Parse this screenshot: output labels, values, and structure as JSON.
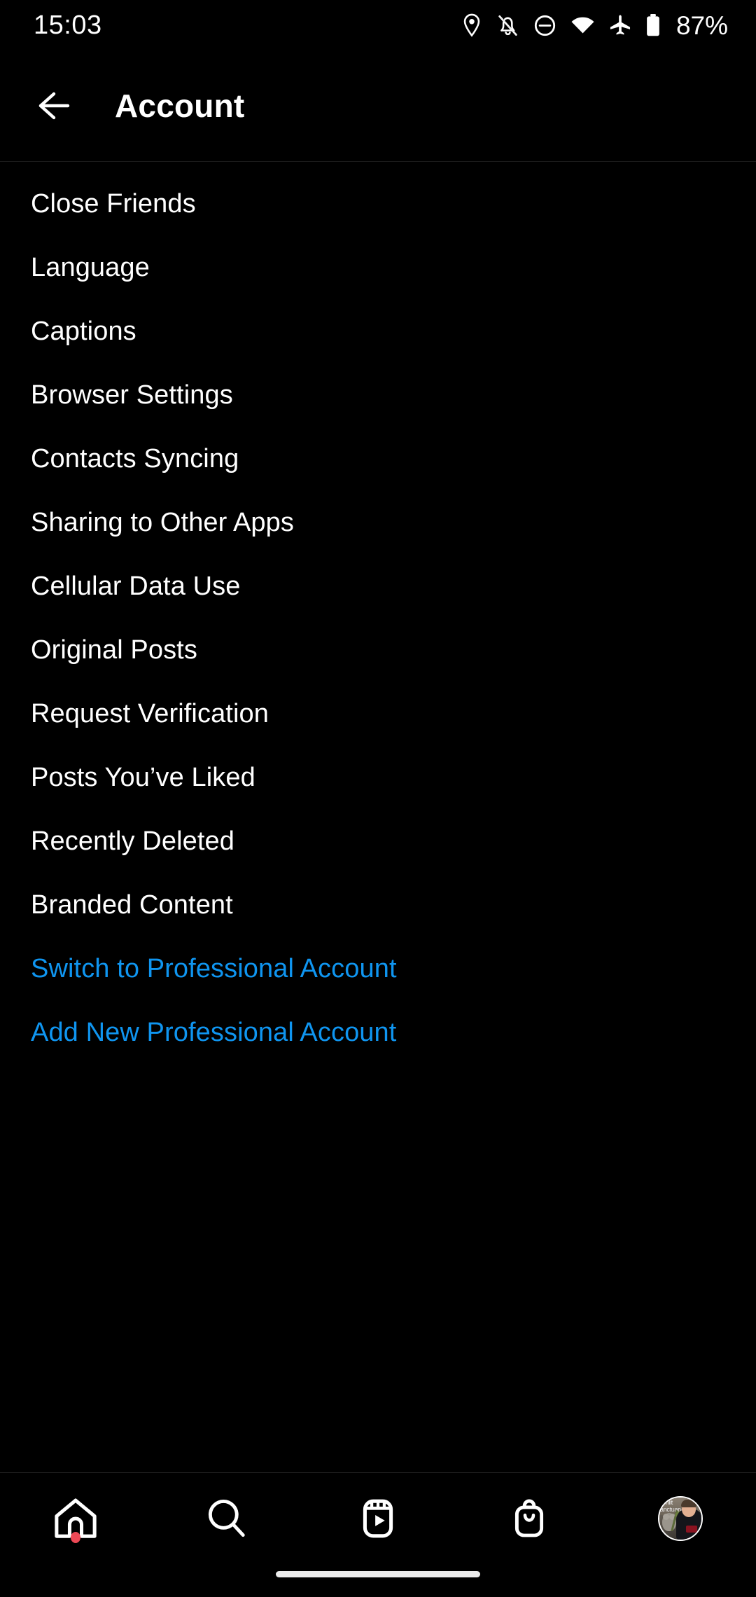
{
  "status_bar": {
    "time": "15:03",
    "battery_percent": "87%",
    "icons": [
      "location-pin-icon",
      "notifications-muted-icon",
      "do-not-disturb-icon",
      "wifi-icon",
      "airplane-mode-icon",
      "battery-icon"
    ]
  },
  "header": {
    "back_icon": "back-arrow-icon",
    "title": "Account"
  },
  "menu": {
    "items": [
      {
        "label": "Close Friends",
        "type": "normal"
      },
      {
        "label": "Language",
        "type": "normal"
      },
      {
        "label": "Captions",
        "type": "normal"
      },
      {
        "label": "Browser Settings",
        "type": "normal"
      },
      {
        "label": "Contacts Syncing",
        "type": "normal"
      },
      {
        "label": "Sharing to Other Apps",
        "type": "normal"
      },
      {
        "label": "Cellular Data Use",
        "type": "normal"
      },
      {
        "label": "Original Posts",
        "type": "normal"
      },
      {
        "label": "Request Verification",
        "type": "normal"
      },
      {
        "label": "Posts You’ve Liked",
        "type": "normal"
      },
      {
        "label": "Recently Deleted",
        "type": "normal"
      },
      {
        "label": "Branded Content",
        "type": "normal"
      },
      {
        "label": "Switch to Professional Account",
        "type": "link"
      },
      {
        "label": "Add New Professional Account",
        "type": "link"
      }
    ]
  },
  "bottom_nav": {
    "items": [
      {
        "name": "home",
        "icon": "home-icon",
        "badge": true
      },
      {
        "name": "search",
        "icon": "search-icon",
        "badge": false
      },
      {
        "name": "reels",
        "icon": "reels-icon",
        "badge": false
      },
      {
        "name": "shop",
        "icon": "shopping-bag-icon",
        "badge": false
      },
      {
        "name": "profile",
        "icon": "profile-avatar",
        "badge": false
      }
    ]
  },
  "colors": {
    "background": "#000000",
    "text_primary": "#ffffff",
    "link_blue": "#0f95f0",
    "divider": "#1c1c1c",
    "badge_red": "#ed4956",
    "home_indicator": "#ebebeb"
  }
}
